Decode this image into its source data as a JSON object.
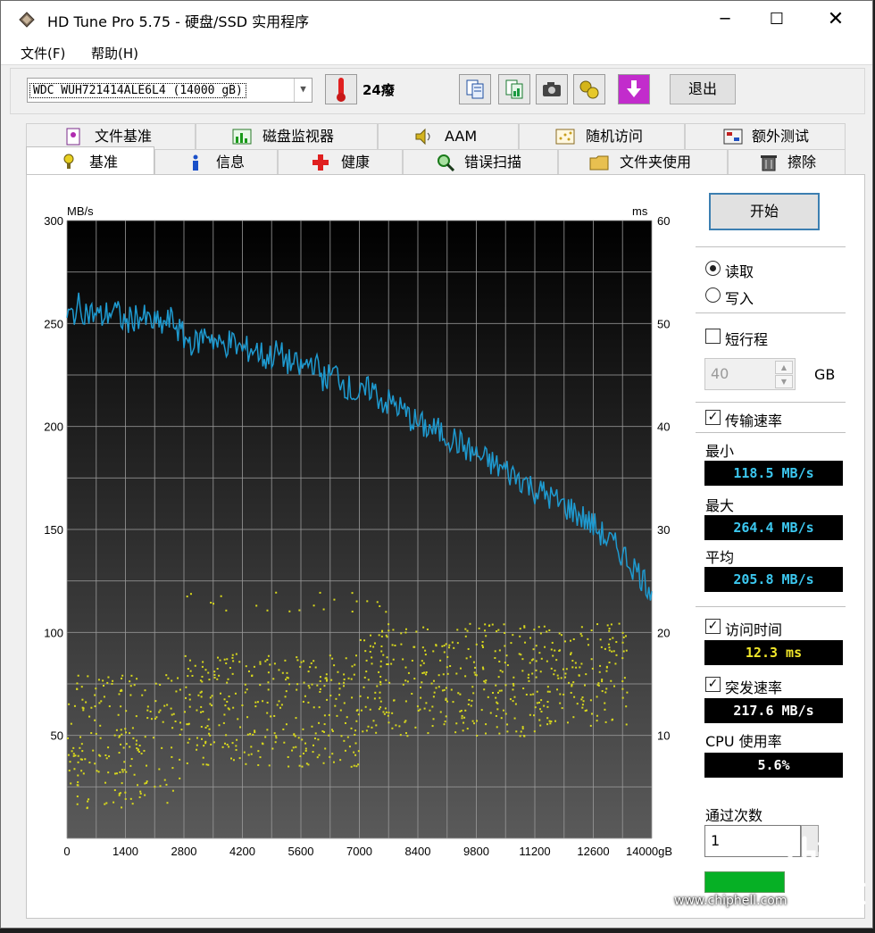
{
  "window": {
    "title": "HD Tune Pro 5.75 - 硬盘/SSD 实用程序",
    "controls": {
      "minimize": "─",
      "maximize": "☐",
      "close": "✕"
    }
  },
  "menu": {
    "file": "文件(F)",
    "help": "帮助(H)"
  },
  "toolbar": {
    "drive": "WDC  WUH721414ALE6L4 (14000 gB)",
    "temperature": "24癈",
    "exit": "退出",
    "icons": [
      "copy-text-icon",
      "copy-image-icon",
      "camera-icon",
      "options-icon",
      "save-down-icon"
    ]
  },
  "tabs_top": [
    "文件基准",
    "磁盘监视器",
    "AAM",
    "随机访问",
    "额外测试"
  ],
  "tabs_bottom": [
    "基准",
    "信息",
    "健康",
    "错误扫描",
    "文件夹使用",
    "擦除"
  ],
  "active_tab": "基准",
  "controls": {
    "start": "开始",
    "read": "读取",
    "write": "写入",
    "mode_selected": "read",
    "short_stroke": "短行程",
    "short_stroke_checked": false,
    "short_stroke_value": "40",
    "short_stroke_unit": "GB",
    "transfer_rate": "传输速率",
    "transfer_rate_checked": true,
    "min_label": "最小",
    "min_value": "118.5 MB/s",
    "max_label": "最大",
    "max_value": "264.4 MB/s",
    "avg_label": "平均",
    "avg_value": "205.8 MB/s",
    "access_time": "访问时间",
    "access_time_checked": true,
    "access_value": "12.3 ms",
    "burst_rate": "突发速率",
    "burst_checked": true,
    "burst_value": "217.6 MB/s",
    "cpu_label": "CPU 使用率",
    "cpu_value": "5.6%",
    "passes_label": "通过次数",
    "passes_value": "1",
    "progress": 1.0
  },
  "watermark": {
    "url": "www.chiphell.com",
    "logo": "chip hell"
  },
  "chart_data": {
    "type": "line",
    "left_axis_unit": "MB/s",
    "right_axis_unit": "ms",
    "x_unit": "gB",
    "y_ticks": [
      50,
      100,
      150,
      200,
      250,
      300
    ],
    "y2_ticks": [
      10,
      20,
      30,
      40,
      50,
      60
    ],
    "x_ticks": [
      0,
      1400,
      2800,
      4200,
      5600,
      7000,
      8400,
      9800,
      11200,
      12600,
      14000
    ],
    "xlim": [
      0,
      14000
    ],
    "ylim": [
      0,
      300
    ],
    "y2lim": [
      0,
      60
    ],
    "grid": true,
    "colors": {
      "transfer": "#1e9ad0",
      "access": "#d8d81c",
      "background_top": "#000000",
      "background_bottom": "#5a5a5a",
      "grid": "#9a9a9a"
    },
    "series": [
      {
        "name": "传输速率",
        "axis": "left",
        "x": [
          0,
          280,
          560,
          840,
          1120,
          1400,
          1680,
          1960,
          2240,
          2520,
          2800,
          3080,
          3360,
          3640,
          3920,
          4200,
          4480,
          4760,
          5040,
          5320,
          5600,
          5880,
          6160,
          6440,
          6720,
          7000,
          7280,
          7560,
          7840,
          8120,
          8400,
          8680,
          8960,
          9240,
          9520,
          9800,
          10080,
          10360,
          10640,
          10920,
          11200,
          11480,
          11760,
          12040,
          12320,
          12600,
          12880,
          13160,
          13440,
          13720,
          14000
        ],
        "values": [
          252,
          258,
          255,
          253,
          257,
          250,
          254,
          251,
          249,
          252,
          243,
          240,
          246,
          239,
          241,
          237,
          238,
          233,
          236,
          231,
          228,
          232,
          223,
          226,
          219,
          214,
          219,
          212,
          211,
          206,
          201,
          199,
          197,
          194,
          190,
          186,
          183,
          180,
          177,
          174,
          169,
          167,
          163,
          160,
          156,
          152,
          146,
          141,
          135,
          128,
          120
        ]
      },
      {
        "name": "访问时间",
        "axis": "right",
        "type": "scatter",
        "description_bands": [
          {
            "x": [
              0,
              2800
            ],
            "ms_range": [
              3,
              16
            ]
          },
          {
            "x": [
              2800,
              7000
            ],
            "ms_range": [
              7,
              18
            ]
          },
          {
            "x": [
              7000,
              11200
            ],
            "ms_range": [
              10,
              21
            ]
          },
          {
            "x": [
              11200,
              13400
            ],
            "ms_range": [
              11,
              21
            ]
          }
        ],
        "outliers_ms": [
          22,
          24
        ]
      }
    ]
  }
}
